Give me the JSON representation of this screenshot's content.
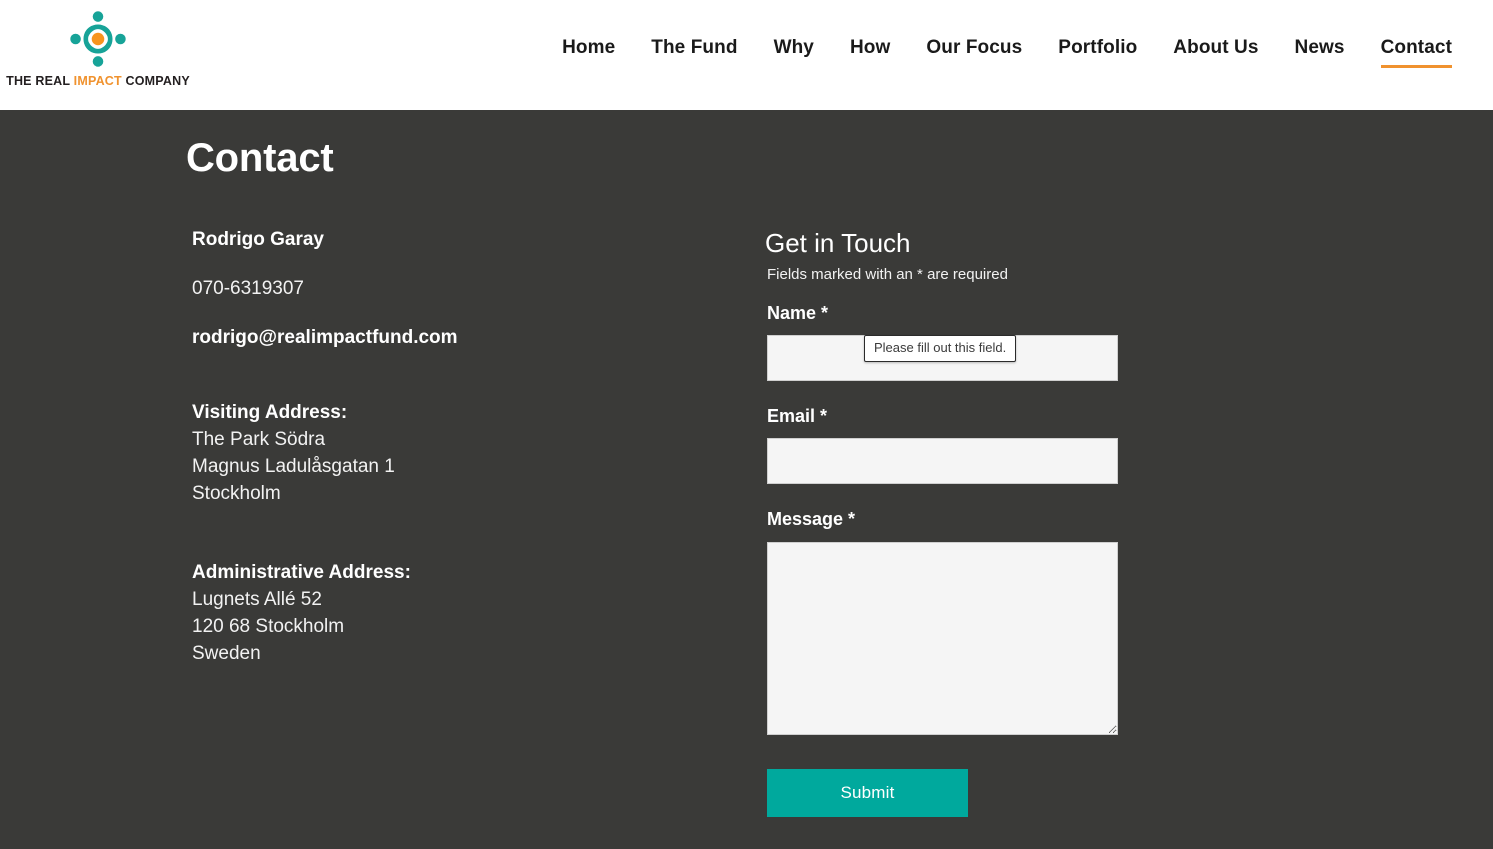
{
  "brand": {
    "logo_icon": "people-circle-logo-icon",
    "text_part1": "THE REAL ",
    "text_accent": "IMPACT",
    "text_part3": " COMPANY",
    "accent_color": "#f0922e",
    "teal_color": "#00a99d"
  },
  "nav": {
    "items": [
      {
        "label": "Home",
        "active": false
      },
      {
        "label": "The Fund",
        "active": false
      },
      {
        "label": "Why",
        "active": false
      },
      {
        "label": "How",
        "active": false
      },
      {
        "label": "Our Focus",
        "active": false
      },
      {
        "label": "Portfolio",
        "active": false
      },
      {
        "label": "About Us",
        "active": false
      },
      {
        "label": "News",
        "active": false
      },
      {
        "label": "Contact",
        "active": true
      }
    ]
  },
  "page": {
    "title": "Contact",
    "background_color": "#3a3a38"
  },
  "contact_info": {
    "name": "Rodrigo Garay",
    "phone": "070-6319307",
    "email": "rodrigo@realimpactfund.com",
    "visiting_address": {
      "heading": "Visiting Address:",
      "lines": [
        "The Park Södra",
        "Magnus Ladulåsgatan 1",
        "Stockholm"
      ]
    },
    "administrative_address": {
      "heading": "Administrative Address:",
      "lines": [
        "Lugnets Allé 52",
        "120 68 Stockholm",
        "Sweden"
      ]
    }
  },
  "form": {
    "heading": "Get in Touch",
    "note": "Fields marked with an * are required",
    "name_label": "Name *",
    "name_value": "",
    "email_label": "Email *",
    "email_value": "",
    "message_label": "Message *",
    "message_value": "",
    "submit_label": "Submit",
    "submit_color": "#00a99d",
    "validation_message": "Please fill out this field."
  }
}
